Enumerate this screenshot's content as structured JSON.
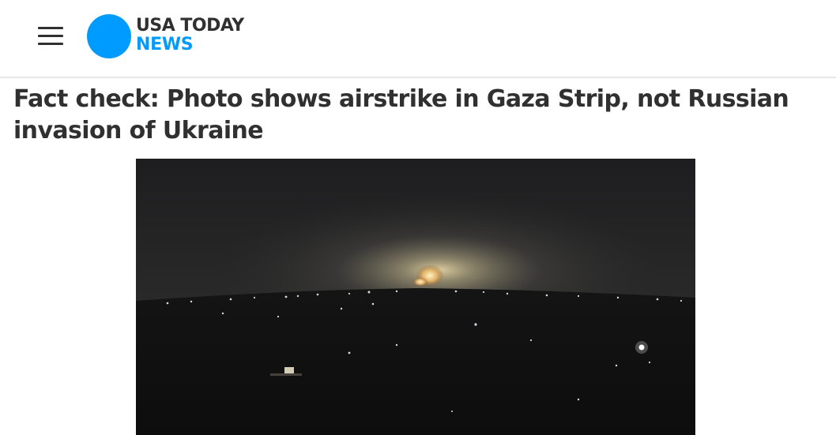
{
  "header": {
    "menu_icon": "hamburger-menu-icon",
    "logo": {
      "line1": "USA TODAY",
      "line2": "NEWS",
      "dot_color": "#009bff",
      "line1_color": "#303030",
      "line2_color": "#009bff"
    }
  },
  "article": {
    "headline": "Fact check: Photo shows airstrike in Gaza Strip, not Russian invasion of Ukraine",
    "image": {
      "subject": "night-explosion-photo"
    }
  },
  "colors": {
    "text": "#303030",
    "brand": "#009bff",
    "divider": "#e6e6e6"
  }
}
